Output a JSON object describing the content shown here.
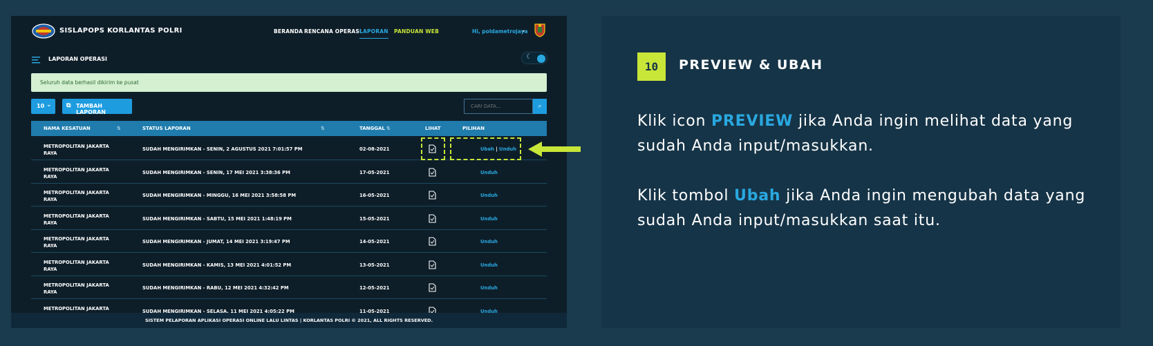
{
  "app": {
    "brand": "SISLAPOPS KORLANTAS POLRI",
    "nav": [
      "BERANDA",
      "RENCANA OPERASI",
      "LAPORAN",
      "PANDUAN WEB"
    ],
    "user": "Hi, poldametrojaya",
    "page_title": "LAPORAN OPERASI",
    "alert": "Seluruh data berhasil dikirim ke pusat",
    "per_page": "10",
    "add_button": "TAMBAH LAPORAN",
    "search_placeholder": "CARI DATA...",
    "columns": [
      "NAMA KESATUAN",
      "STATUS LAPORAN",
      "TANGGAL",
      "LIHAT",
      "PILIHAN"
    ],
    "rows": [
      {
        "unit": "METROPOLITAN JAKARTA RAYA",
        "status": "SUDAH MENGIRIMKAN - SENIN, 2 AGUSTUS 2021 7:01:57 PM",
        "date": "02-08-2021",
        "edit": "Ubah",
        "sep": "|",
        "download": "Unduh"
      },
      {
        "unit": "METROPOLITAN JAKARTA RAYA",
        "status": "SUDAH MENGIRIMKAN - SENIN, 17 MEI 2021 3:38:36 PM",
        "date": "17-05-2021",
        "download": "Unduh"
      },
      {
        "unit": "METROPOLITAN JAKARTA RAYA",
        "status": "SUDAH MENGIRIMKAN - MINGGU, 16 MEI 2021 3:58:58 PM",
        "date": "16-05-2021",
        "download": "Unduh"
      },
      {
        "unit": "METROPOLITAN JAKARTA RAYA",
        "status": "SUDAH MENGIRIMKAN - SABTU, 15 MEI 2021 1:48:19 PM",
        "date": "15-05-2021",
        "download": "Unduh"
      },
      {
        "unit": "METROPOLITAN JAKARTA RAYA",
        "status": "SUDAH MENGIRIMKAN - JUMAT, 14 MEI 2021 3:19:47 PM",
        "date": "14-05-2021",
        "download": "Unduh"
      },
      {
        "unit": "METROPOLITAN JAKARTA RAYA",
        "status": "SUDAH MENGIRIMKAN - KAMIS, 13 MEI 2021 4:01:52 PM",
        "date": "13-05-2021",
        "download": "Unduh"
      },
      {
        "unit": "METROPOLITAN JAKARTA RAYA",
        "status": "SUDAH MENGIRIMKAN - RABU, 12 MEI 2021 4:32:42 PM",
        "date": "12-05-2021",
        "download": "Unduh"
      },
      {
        "unit": "METROPOLITAN JAKARTA RAYA",
        "status": "SUDAH MENGIRIMKAN - SELASA, 11 MEI 2021 4:05:22 PM",
        "date": "11-05-2021",
        "download": "Unduh"
      }
    ],
    "footer": "SISTEM PELAPORAN APLIKASI OPERASI ONLINE LALU LINTAS | KORLANTAS POLRI © 2021, ALL RIGHTS RESERVED."
  },
  "info": {
    "step": "10",
    "title": "PREVIEW & UBAH",
    "p1_pre": "Klik icon ",
    "p1_key": "PREVIEW",
    "p1_post": " jika Anda ingin melihat data yang sudah Anda input/masukkan.",
    "p2_pre": "Klik tombol ",
    "p2_key": "Ubah",
    "p2_post": " jika Anda ingin mengubah data yang sudah Anda input/masukkan saat itu."
  },
  "colors": {
    "accent": "#29a8e0",
    "highlight": "#c8e638",
    "panel": "#163447",
    "app_bg": "#0e1e29"
  }
}
